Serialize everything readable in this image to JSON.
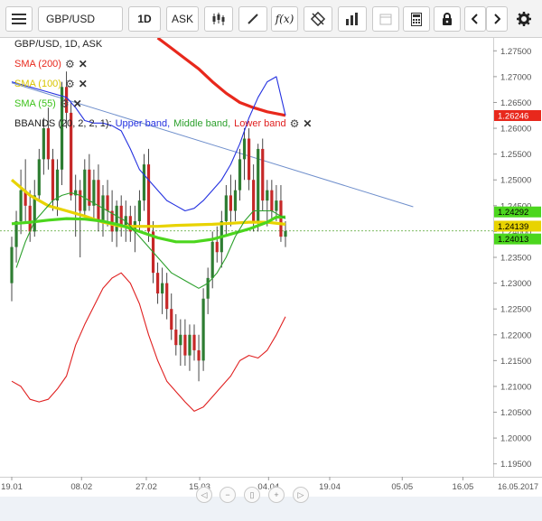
{
  "toolbar": {
    "symbol": "GBP/USD",
    "timeframe": "1D",
    "price_side": "ASK",
    "icons": [
      "menu-icon",
      "candlestick-type-icon",
      "draw-line-icon",
      "function-icon",
      "crosshair-off-icon",
      "volume-bars-icon",
      "calendar-icon",
      "calculator-icon",
      "lock-icon",
      "prev-icon",
      "next-icon",
      "settings-icon"
    ],
    "fx_label": "f(x)"
  },
  "legend": {
    "instrument": "GBP/USD, 1D, ASK",
    "sma200": "SMA (200)",
    "sma100": "SMA (100)",
    "sma55": "SMA (55)",
    "bbands_prefix": "BBANDS (20, 2, 2, 1):",
    "upper": "Upper band,",
    "middle": "Middle band,",
    "lower": "Lower band"
  },
  "colors": {
    "sma200": "#e8281c",
    "sma100": "#e8d300",
    "sma55": "#4cd61e",
    "upper_band": "#2431e0",
    "middle_band": "#2ca02c",
    "lower_band": "#e02020",
    "trendline": "#6f8fcc",
    "bull": "#2e7d32",
    "bear": "#c62828"
  },
  "chart_data": {
    "type": "candlestick",
    "y_axis_ticks": [
      "1.27500",
      "1.27000",
      "1.26500",
      "1.26000",
      "1.25500",
      "1.25000",
      "1.24500",
      "1.24000",
      "1.23500",
      "1.23000",
      "1.22500",
      "1.22000",
      "1.21500",
      "1.21000",
      "1.20500",
      "1.20000",
      "1.19500"
    ],
    "ylim": [
      1.1925,
      1.2775
    ],
    "x_axis_ticks": [
      "19.01",
      "08.02",
      "27.02",
      "15.03",
      "04.04",
      "19.04",
      "05.05",
      "16.05",
      "16.05.2017"
    ],
    "price_labels": [
      {
        "value": 1.26246,
        "text": "1.26246",
        "color": "#e8281c"
      },
      {
        "value": 1.24292,
        "text": "1.24292",
        "color": "#4cd61e"
      },
      {
        "value": 1.24139,
        "text": "1.24139",
        "color": "#e8d300"
      },
      {
        "value": 1.24013,
        "text": "1.24013",
        "color": "#4cd61e"
      }
    ],
    "candles": [
      {
        "o": 1.23,
        "h": 1.239,
        "l": 1.2265,
        "c": 1.237
      },
      {
        "o": 1.237,
        "h": 1.244,
        "l": 1.234,
        "c": 1.242
      },
      {
        "o": 1.242,
        "h": 1.252,
        "l": 1.2395,
        "c": 1.248
      },
      {
        "o": 1.248,
        "h": 1.254,
        "l": 1.242,
        "c": 1.245
      },
      {
        "o": 1.245,
        "h": 1.248,
        "l": 1.238,
        "c": 1.24
      },
      {
        "o": 1.24,
        "h": 1.25,
        "l": 1.239,
        "c": 1.247
      },
      {
        "o": 1.247,
        "h": 1.256,
        "l": 1.246,
        "c": 1.254
      },
      {
        "o": 1.254,
        "h": 1.262,
        "l": 1.251,
        "c": 1.26
      },
      {
        "o": 1.26,
        "h": 1.264,
        "l": 1.252,
        "c": 1.254
      },
      {
        "o": 1.254,
        "h": 1.256,
        "l": 1.244,
        "c": 1.246
      },
      {
        "o": 1.246,
        "h": 1.254,
        "l": 1.243,
        "c": 1.252
      },
      {
        "o": 1.252,
        "h": 1.269,
        "l": 1.249,
        "c": 1.268
      },
      {
        "o": 1.268,
        "h": 1.271,
        "l": 1.26,
        "c": 1.263
      },
      {
        "o": 1.263,
        "h": 1.265,
        "l": 1.246,
        "c": 1.247
      },
      {
        "o": 1.247,
        "h": 1.251,
        "l": 1.239,
        "c": 1.248
      },
      {
        "o": 1.248,
        "h": 1.25,
        "l": 1.235,
        "c": 1.244
      },
      {
        "o": 1.244,
        "h": 1.254,
        "l": 1.243,
        "c": 1.252
      },
      {
        "o": 1.252,
        "h": 1.255,
        "l": 1.244,
        "c": 1.245
      },
      {
        "o": 1.245,
        "h": 1.252,
        "l": 1.242,
        "c": 1.25
      },
      {
        "o": 1.25,
        "h": 1.253,
        "l": 1.24,
        "c": 1.242
      },
      {
        "o": 1.242,
        "h": 1.249,
        "l": 1.239,
        "c": 1.247
      },
      {
        "o": 1.247,
        "h": 1.25,
        "l": 1.241,
        "c": 1.244
      },
      {
        "o": 1.244,
        "h": 1.248,
        "l": 1.238,
        "c": 1.24
      },
      {
        "o": 1.24,
        "h": 1.246,
        "l": 1.237,
        "c": 1.245
      },
      {
        "o": 1.245,
        "h": 1.247,
        "l": 1.239,
        "c": 1.241
      },
      {
        "o": 1.241,
        "h": 1.246,
        "l": 1.238,
        "c": 1.243
      },
      {
        "o": 1.243,
        "h": 1.245,
        "l": 1.238,
        "c": 1.24
      },
      {
        "o": 1.24,
        "h": 1.245,
        "l": 1.236,
        "c": 1.242
      },
      {
        "o": 1.242,
        "h": 1.248,
        "l": 1.24,
        "c": 1.246
      },
      {
        "o": 1.246,
        "h": 1.255,
        "l": 1.244,
        "c": 1.253
      },
      {
        "o": 1.253,
        "h": 1.256,
        "l": 1.238,
        "c": 1.24
      },
      {
        "o": 1.24,
        "h": 1.242,
        "l": 1.23,
        "c": 1.232
      },
      {
        "o": 1.232,
        "h": 1.234,
        "l": 1.226,
        "c": 1.228
      },
      {
        "o": 1.228,
        "h": 1.233,
        "l": 1.224,
        "c": 1.23
      },
      {
        "o": 1.23,
        "h": 1.232,
        "l": 1.223,
        "c": 1.225
      },
      {
        "o": 1.225,
        "h": 1.228,
        "l": 1.219,
        "c": 1.221
      },
      {
        "o": 1.221,
        "h": 1.224,
        "l": 1.216,
        "c": 1.218
      },
      {
        "o": 1.218,
        "h": 1.223,
        "l": 1.214,
        "c": 1.22
      },
      {
        "o": 1.22,
        "h": 1.223,
        "l": 1.214,
        "c": 1.216
      },
      {
        "o": 1.216,
        "h": 1.222,
        "l": 1.213,
        "c": 1.22
      },
      {
        "o": 1.22,
        "h": 1.222,
        "l": 1.215,
        "c": 1.217
      },
      {
        "o": 1.217,
        "h": 1.22,
        "l": 1.211,
        "c": 1.215
      },
      {
        "o": 1.215,
        "h": 1.229,
        "l": 1.213,
        "c": 1.227
      },
      {
        "o": 1.227,
        "h": 1.233,
        "l": 1.224,
        "c": 1.231
      },
      {
        "o": 1.231,
        "h": 1.24,
        "l": 1.229,
        "c": 1.238
      },
      {
        "o": 1.238,
        "h": 1.241,
        "l": 1.234,
        "c": 1.236
      },
      {
        "o": 1.236,
        "h": 1.244,
        "l": 1.233,
        "c": 1.242
      },
      {
        "o": 1.242,
        "h": 1.249,
        "l": 1.239,
        "c": 1.247
      },
      {
        "o": 1.247,
        "h": 1.251,
        "l": 1.241,
        "c": 1.244
      },
      {
        "o": 1.244,
        "h": 1.25,
        "l": 1.242,
        "c": 1.248
      },
      {
        "o": 1.248,
        "h": 1.256,
        "l": 1.246,
        "c": 1.254
      },
      {
        "o": 1.254,
        "h": 1.26,
        "l": 1.25,
        "c": 1.258
      },
      {
        "o": 1.258,
        "h": 1.26,
        "l": 1.248,
        "c": 1.25
      },
      {
        "o": 1.25,
        "h": 1.253,
        "l": 1.24,
        "c": 1.242
      },
      {
        "o": 1.242,
        "h": 1.257,
        "l": 1.24,
        "c": 1.256
      },
      {
        "o": 1.256,
        "h": 1.258,
        "l": 1.244,
        "c": 1.246
      },
      {
        "o": 1.246,
        "h": 1.25,
        "l": 1.241,
        "c": 1.248
      },
      {
        "o": 1.248,
        "h": 1.25,
        "l": 1.242,
        "c": 1.244
      },
      {
        "o": 1.244,
        "h": 1.249,
        "l": 1.242,
        "c": 1.246
      },
      {
        "o": 1.246,
        "h": 1.249,
        "l": 1.238,
        "c": 1.239
      },
      {
        "o": 1.239,
        "h": 1.242,
        "l": 1.237,
        "c": 1.2401
      }
    ],
    "series": [
      {
        "name": "SMA (200)",
        "values": [
          [
            0,
            null
          ],
          [
            28,
            null
          ],
          [
            32,
            1.2775
          ],
          [
            35,
            1.2755
          ],
          [
            38,
            1.2735
          ],
          [
            41,
            1.2715
          ],
          [
            44,
            1.269
          ],
          [
            47,
            1.2668
          ],
          [
            50,
            1.265
          ],
          [
            53,
            1.264
          ],
          [
            56,
            1.2632
          ],
          [
            60,
            1.2625
          ]
        ]
      },
      {
        "name": "SMA (100)",
        "values": [
          [
            0,
            1.25
          ],
          [
            4,
            1.247
          ],
          [
            8,
            1.245
          ],
          [
            12,
            1.244
          ],
          [
            16,
            1.243
          ],
          [
            20,
            1.2418
          ],
          [
            24,
            1.241
          ],
          [
            28,
            1.241
          ],
          [
            32,
            1.241
          ],
          [
            36,
            1.2412
          ],
          [
            40,
            1.2413
          ],
          [
            44,
            1.2414
          ],
          [
            48,
            1.2416
          ],
          [
            52,
            1.2418
          ],
          [
            56,
            1.2418
          ],
          [
            60,
            1.2414
          ]
        ]
      },
      {
        "name": "SMA (55)",
        "values": [
          [
            0,
            1.2415
          ],
          [
            4,
            1.2418
          ],
          [
            8,
            1.2422
          ],
          [
            12,
            1.2425
          ],
          [
            16,
            1.2424
          ],
          [
            20,
            1.242
          ],
          [
            24,
            1.2412
          ],
          [
            28,
            1.24
          ],
          [
            32,
            1.2388
          ],
          [
            36,
            1.238
          ],
          [
            40,
            1.238
          ],
          [
            44,
            1.2385
          ],
          [
            48,
            1.2395
          ],
          [
            52,
            1.2405
          ],
          [
            56,
            1.2418
          ],
          [
            58,
            1.2428
          ],
          [
            60,
            1.2428
          ]
        ]
      },
      {
        "name": "Upper band",
        "values": [
          [
            0,
            1.269
          ],
          [
            4,
            1.268
          ],
          [
            8,
            1.267
          ],
          [
            12,
            1.266
          ],
          [
            14,
            1.264
          ],
          [
            16,
            1.2615
          ],
          [
            18,
            1.261
          ],
          [
            20,
            1.261
          ],
          [
            22,
            1.2605
          ],
          [
            24,
            1.2595
          ],
          [
            26,
            1.256
          ],
          [
            28,
            1.252
          ],
          [
            30,
            1.25
          ],
          [
            32,
            1.248
          ],
          [
            34,
            1.246
          ],
          [
            36,
            1.245
          ],
          [
            38,
            1.244
          ],
          [
            40,
            1.2445
          ],
          [
            42,
            1.246
          ],
          [
            44,
            1.248
          ],
          [
            46,
            1.25
          ],
          [
            48,
            1.253
          ],
          [
            50,
            1.257
          ],
          [
            52,
            1.262
          ],
          [
            54,
            1.266
          ],
          [
            56,
            1.269
          ],
          [
            58,
            1.27
          ],
          [
            60,
            1.2625
          ]
        ]
      },
      {
        "name": "Middle band",
        "values": [
          [
            1,
            1.233
          ],
          [
            3,
            1.238
          ],
          [
            5,
            1.242
          ],
          [
            7,
            1.244
          ],
          [
            9,
            1.246
          ],
          [
            11,
            1.247
          ],
          [
            13,
            1.2475
          ],
          [
            15,
            1.247
          ],
          [
            17,
            1.246
          ],
          [
            19,
            1.245
          ],
          [
            21,
            1.244
          ],
          [
            23,
            1.243
          ],
          [
            25,
            1.242
          ],
          [
            27,
            1.24
          ],
          [
            29,
            1.238
          ],
          [
            31,
            1.236
          ],
          [
            33,
            1.234
          ],
          [
            35,
            1.232
          ],
          [
            37,
            1.231
          ],
          [
            39,
            1.23
          ],
          [
            41,
            1.229
          ],
          [
            43,
            1.23
          ],
          [
            45,
            1.232
          ],
          [
            47,
            1.235
          ],
          [
            49,
            1.239
          ],
          [
            51,
            1.242
          ],
          [
            53,
            1.244
          ],
          [
            55,
            1.244
          ],
          [
            57,
            1.244
          ],
          [
            59,
            1.243
          ],
          [
            60,
            1.2425
          ]
        ]
      },
      {
        "name": "Lower band",
        "values": [
          [
            0,
            1.211
          ],
          [
            2,
            1.21
          ],
          [
            4,
            1.2075
          ],
          [
            6,
            1.207
          ],
          [
            8,
            1.2075
          ],
          [
            10,
            1.2095
          ],
          [
            12,
            1.212
          ],
          [
            14,
            1.218
          ],
          [
            16,
            1.222
          ],
          [
            18,
            1.2255
          ],
          [
            20,
            1.229
          ],
          [
            22,
            1.231
          ],
          [
            24,
            1.232
          ],
          [
            26,
            1.23
          ],
          [
            28,
            1.226
          ],
          [
            30,
            1.22
          ],
          [
            32,
            1.215
          ],
          [
            34,
            1.211
          ],
          [
            36,
            1.209
          ],
          [
            38,
            1.207
          ],
          [
            40,
            1.2052
          ],
          [
            42,
            1.206
          ],
          [
            44,
            1.208
          ],
          [
            46,
            1.21
          ],
          [
            48,
            1.212
          ],
          [
            50,
            1.215
          ],
          [
            52,
            1.216
          ],
          [
            54,
            1.2155
          ],
          [
            56,
            1.217
          ],
          [
            58,
            1.22
          ],
          [
            60,
            1.2235
          ]
        ]
      }
    ],
    "trendline": {
      "x1": 0,
      "y1": 1.2688,
      "x2": 88,
      "y2": 1.2448
    }
  }
}
